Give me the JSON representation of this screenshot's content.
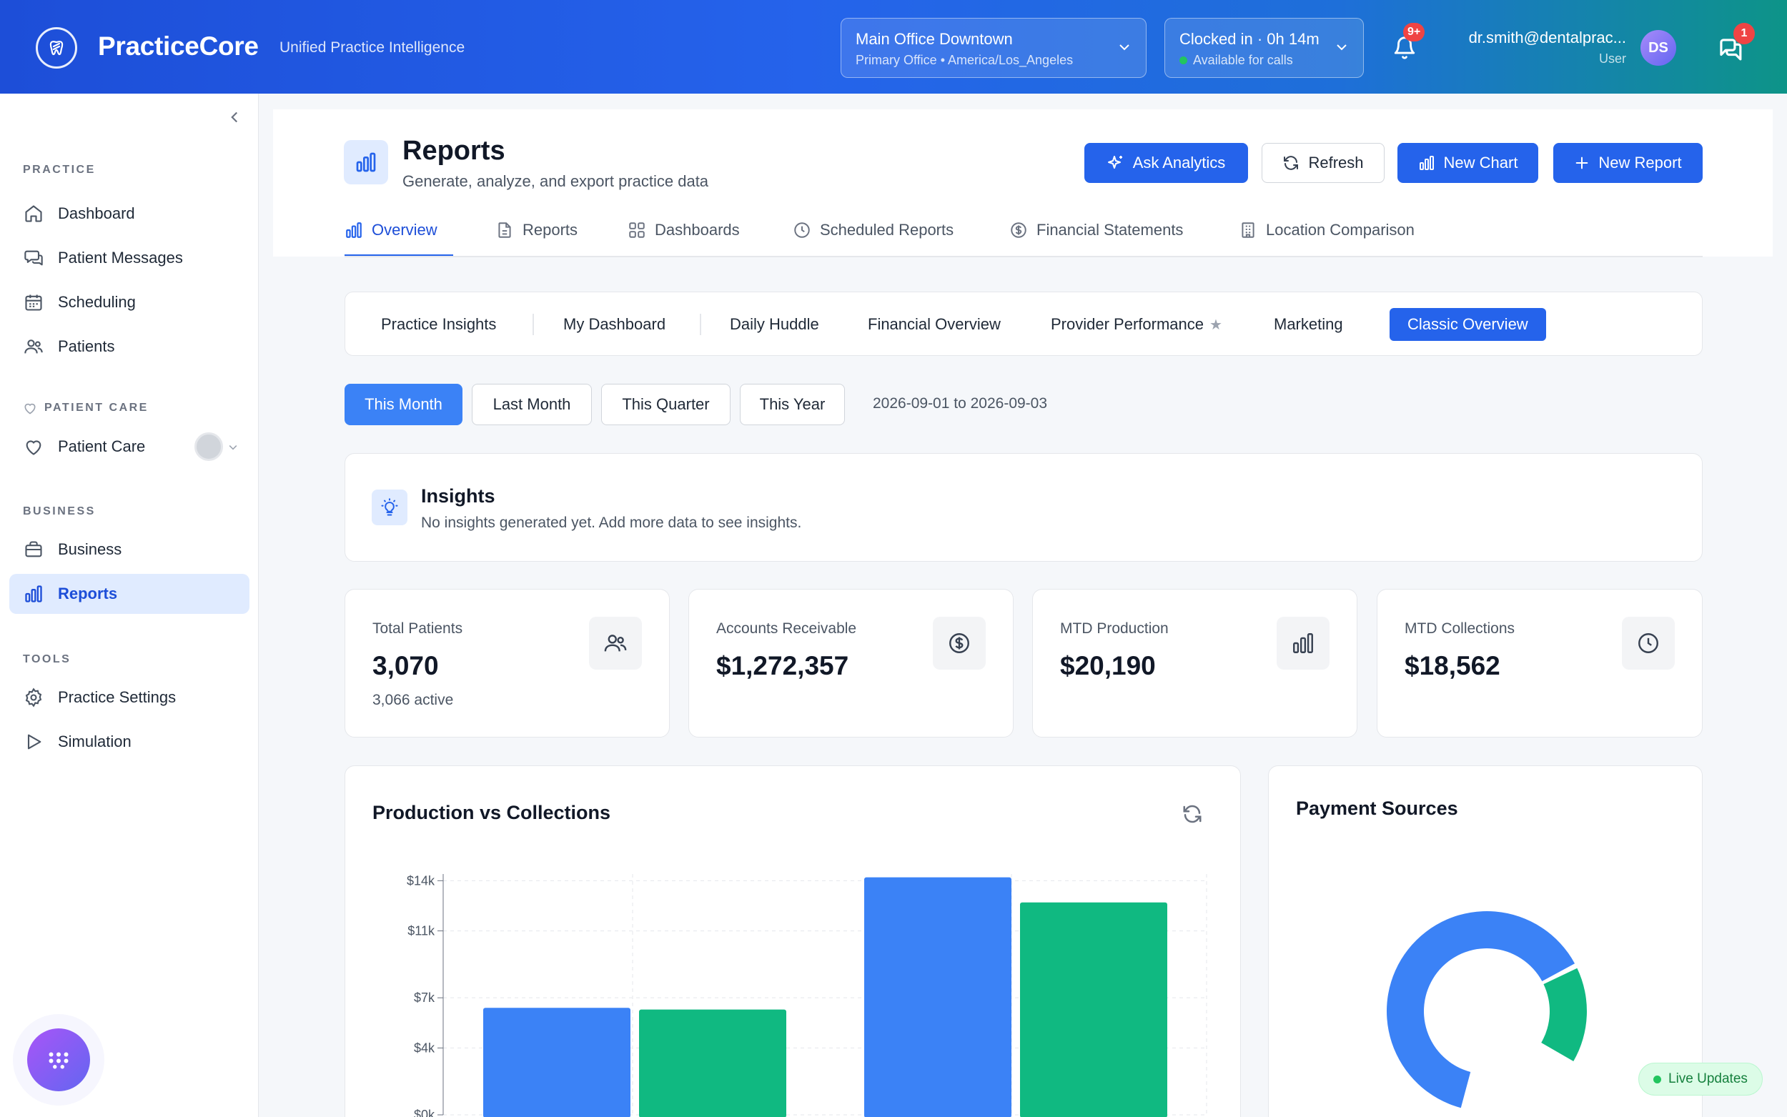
{
  "header": {
    "brand": "PracticeCore",
    "tagline": "Unified Practice Intelligence",
    "location": {
      "name": "Main Office Downtown",
      "detail": "Primary Office • America/Los_Angeles"
    },
    "clock": {
      "status": "Clocked in · 0h 14m",
      "availability": "Available for calls"
    },
    "notifications_badge": "9+",
    "messages_badge": "1",
    "user": {
      "email": "dr.smith@dentalprac...",
      "role": "User",
      "initials": "DS"
    }
  },
  "sidebar": {
    "sections": [
      {
        "title": "PRACTICE"
      },
      {
        "title": "PATIENT CARE"
      },
      {
        "title": "BUSINESS"
      },
      {
        "title": "TOOLS"
      }
    ],
    "items": [
      {
        "label": "Dashboard"
      },
      {
        "label": "Patient Messages"
      },
      {
        "label": "Scheduling"
      },
      {
        "label": "Patients"
      },
      {
        "label": "Patient Care"
      },
      {
        "label": "Business"
      },
      {
        "label": "Reports"
      },
      {
        "label": "Practice Settings"
      },
      {
        "label": "Simulation"
      }
    ]
  },
  "page": {
    "title": "Reports",
    "subtitle": "Generate, analyze, and export practice data",
    "actions": {
      "ask": "Ask Analytics",
      "refresh": "Refresh",
      "new_chart": "New Chart",
      "new_report": "New Report"
    },
    "tabs": [
      "Overview",
      "Reports",
      "Dashboards",
      "Scheduled Reports",
      "Financial Statements",
      "Location Comparison"
    ],
    "subtabs": [
      "Practice Insights",
      "My Dashboard",
      "Daily Huddle",
      "Financial Overview",
      "Provider Performance",
      "Marketing",
      "Classic Overview"
    ],
    "periods": [
      "This Month",
      "Last Month",
      "This Quarter",
      "This Year"
    ],
    "date_range": "2026-09-01 to 2026-09-03"
  },
  "insights": {
    "title": "Insights",
    "text": "No insights generated yet. Add more data to see insights."
  },
  "kpis": [
    {
      "label": "Total Patients",
      "value": "3,070",
      "sub": "3,066 active",
      "icon": "users-icon"
    },
    {
      "label": "Accounts Receivable",
      "value": "$1,272,357",
      "icon": "dollar-icon"
    },
    {
      "label": "MTD Production",
      "value": "$20,190",
      "icon": "bar-chart-icon"
    },
    {
      "label": "MTD Collections",
      "value": "$18,562",
      "icon": "clock-icon"
    }
  ],
  "chart_data": [
    {
      "type": "bar",
      "title": "Production vs Collections",
      "tick_labels": [
        "$14k",
        "$11k",
        "$7k",
        "$4k",
        "$0k"
      ],
      "ylim": [
        0,
        14
      ],
      "grid": true,
      "colors": [
        "#3b82f6",
        "#10b981"
      ],
      "series": [
        {
          "values": [
            6.4,
            14.2
          ]
        },
        {
          "values": [
            6.3,
            12.7
          ]
        }
      ]
    },
    {
      "type": "pie",
      "title": "Payment Sources",
      "colors": [
        "#3b82f6",
        "#10b981"
      ],
      "values": [
        80,
        20
      ]
    }
  ],
  "status": {
    "live": "Live Updates"
  },
  "colors": {
    "primary": "#2563eb",
    "accent_green": "#10b981",
    "danger": "#ef4444"
  }
}
